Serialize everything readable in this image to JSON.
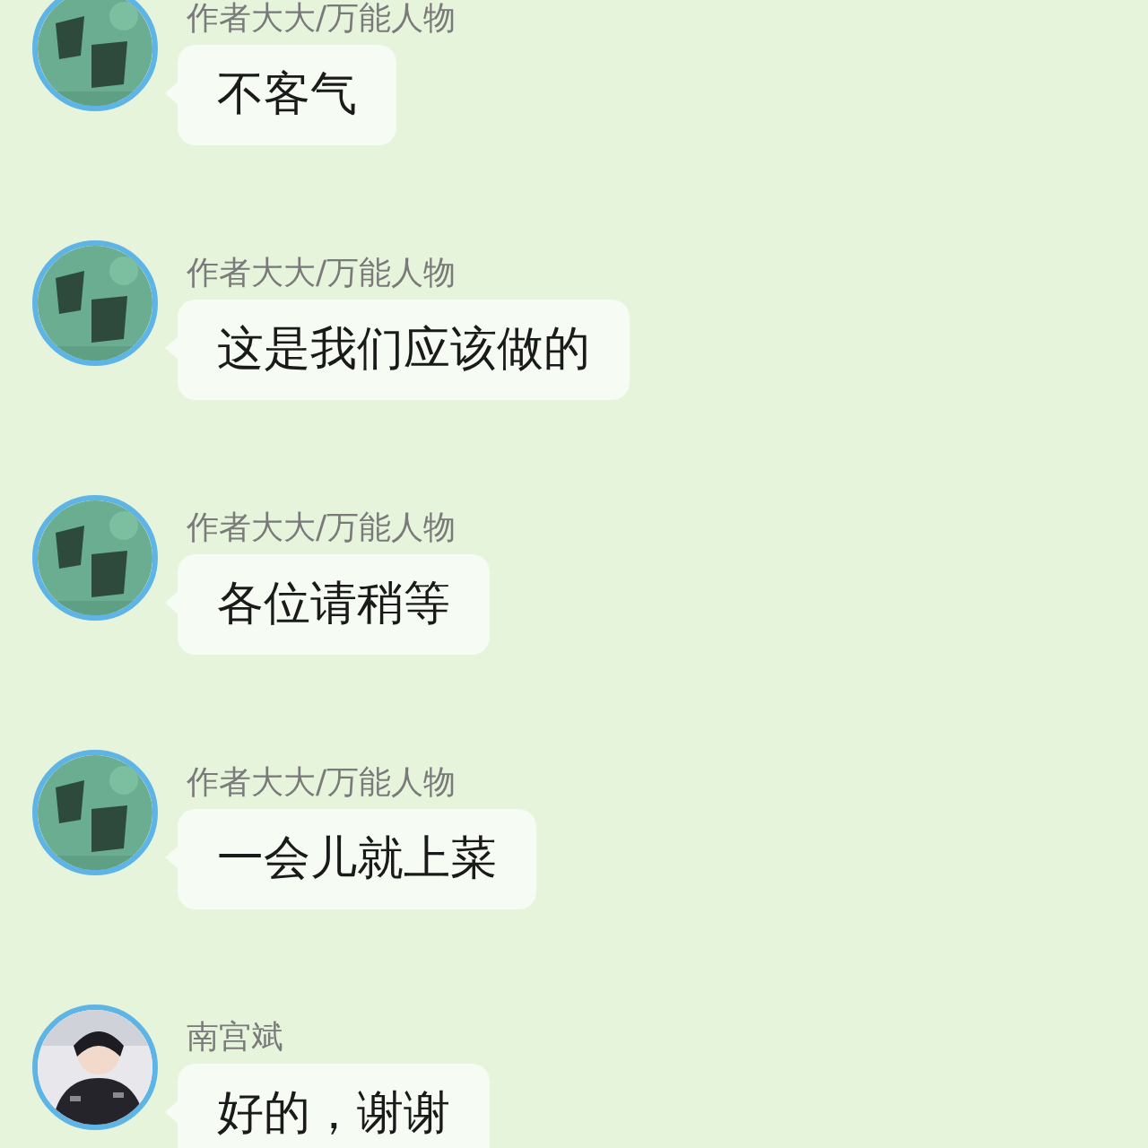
{
  "messages": [
    {
      "sender": "作者大大/万能人物",
      "text": "不客气",
      "avatar": {
        "kind": "emblem"
      }
    },
    {
      "sender": "作者大大/万能人物",
      "text": "这是我们应该做的",
      "avatar": {
        "kind": "emblem"
      }
    },
    {
      "sender": "作者大大/万能人物",
      "text": "各位请稍等",
      "avatar": {
        "kind": "emblem"
      }
    },
    {
      "sender": "作者大大/万能人物",
      "text": "一会儿就上菜",
      "avatar": {
        "kind": "emblem"
      }
    },
    {
      "sender": "南宫斌",
      "text": "好的，谢谢"
    }
  ]
}
